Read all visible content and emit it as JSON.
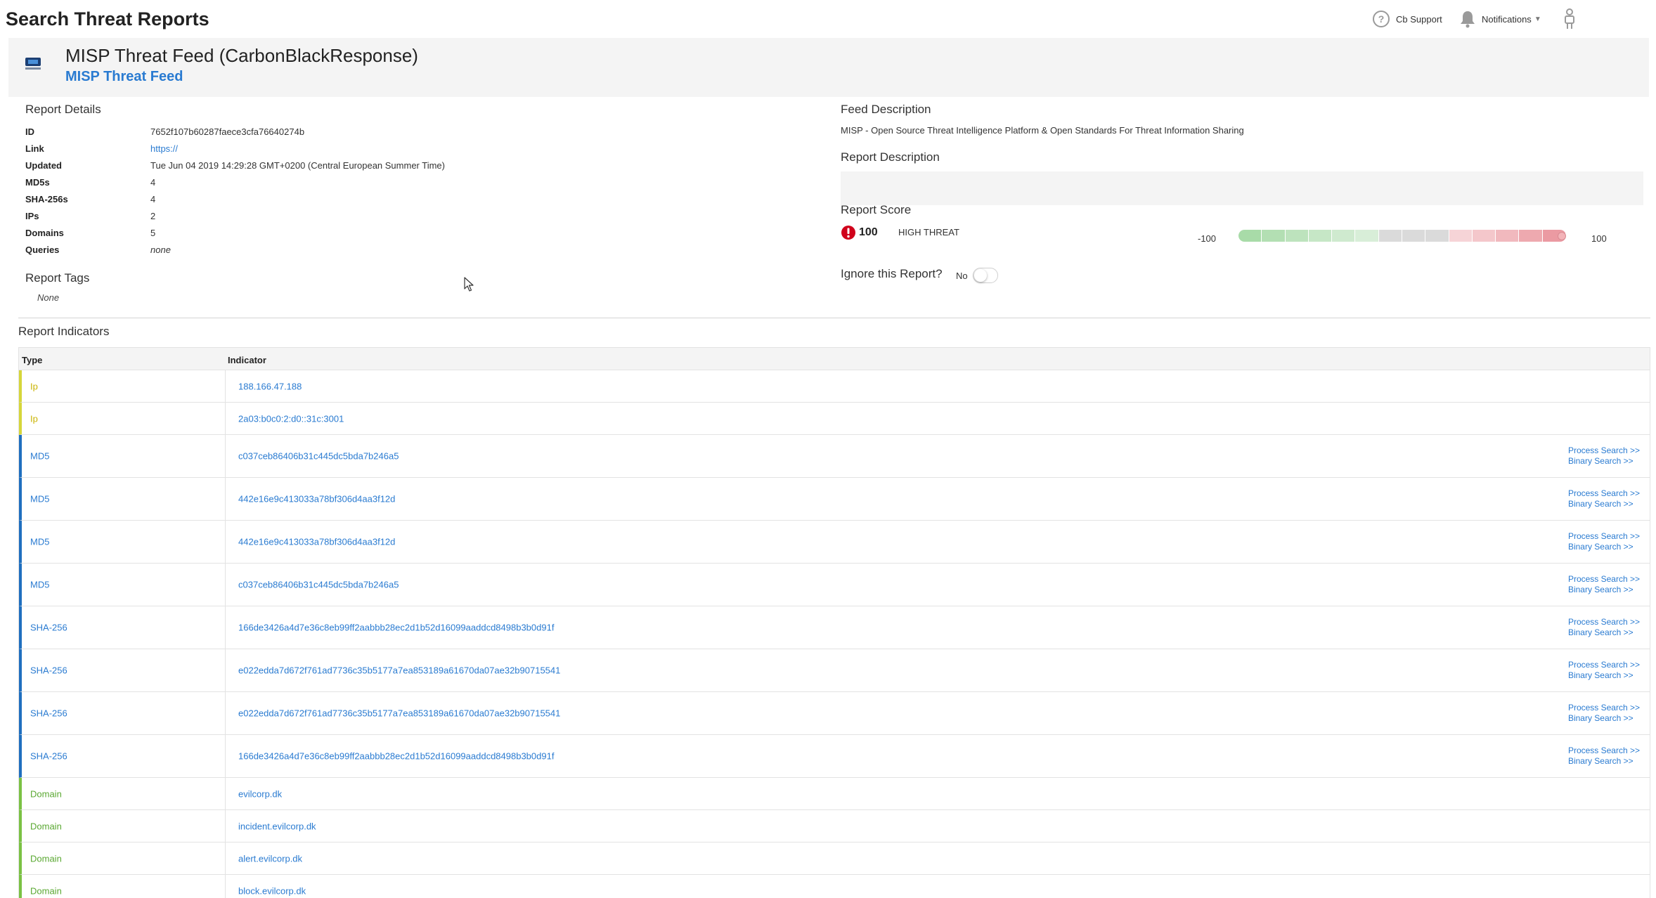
{
  "page": {
    "title": "Search Threat Reports"
  },
  "topbar": {
    "support_label": "Cb Support",
    "notifications_label": "Notifications"
  },
  "feed": {
    "title": "MISP Threat Feed (CarbonBlackResponse)",
    "link_label": "MISP Threat Feed"
  },
  "details": {
    "heading": "Report Details",
    "rows": [
      {
        "key": "ID",
        "value": "7652f107b60287faece3cfa76640274b"
      },
      {
        "key": "Link",
        "value": "https://"
      },
      {
        "key": "Updated",
        "value": "Tue Jun 04 2019 14:29:28 GMT+0200 (Central European Summer Time)"
      },
      {
        "key": "MD5s",
        "value": "4"
      },
      {
        "key": "SHA-256s",
        "value": "4"
      },
      {
        "key": "IPs",
        "value": "2"
      },
      {
        "key": "Domains",
        "value": "5"
      },
      {
        "key": "Queries",
        "value": "none"
      }
    ]
  },
  "tags": {
    "heading": "Report Tags",
    "none_label": "None"
  },
  "feed_description": {
    "heading": "Feed Description",
    "text": "MISP - Open Source Threat Intelligence Platform & Open Standards For Threat Information Sharing"
  },
  "report_description": {
    "heading": "Report Description"
  },
  "score": {
    "heading": "Report Score",
    "value": "100",
    "level": "HIGH THREAT",
    "min_label": "-100",
    "max_label": "100",
    "fraction": 0.99,
    "bar_colors": [
      "#a8dba8",
      "#b3dfb3",
      "#bde3bd",
      "#c6e7c6",
      "#cfeacf",
      "#d8eed8",
      "#dadada",
      "#dadada",
      "#dadada",
      "#f6d4d7",
      "#f4c7cb",
      "#f1b9be",
      "#eea9af",
      "#eb9aa2"
    ],
    "icon_color": "#d0021b"
  },
  "ignore": {
    "label": "Ignore this Report?",
    "value": "No",
    "on": false
  },
  "indicators": {
    "heading": "Report Indicators",
    "columns": {
      "type": "Type",
      "indicator": "Indicator"
    },
    "action_process": "Process Search >>",
    "action_binary": "Binary Search >>",
    "rows": [
      {
        "type": "Ip",
        "value": "188.166.47.188"
      },
      {
        "type": "Ip",
        "value": "2a03:b0c0:2:d0::31c:3001"
      },
      {
        "type": "MD5",
        "value": "c037ceb86406b31c445dc5bda7b246a5"
      },
      {
        "type": "MD5",
        "value": "442e16e9c413033a78bf306d4aa3f12d"
      },
      {
        "type": "MD5",
        "value": "442e16e9c413033a78bf306d4aa3f12d"
      },
      {
        "type": "MD5",
        "value": "c037ceb86406b31c445dc5bda7b246a5"
      },
      {
        "type": "SHA-256",
        "value": "166de3426a4d7e36c8eb99ff2aabbb28ec2d1b52d16099aaddcd8498b3b0d91f"
      },
      {
        "type": "SHA-256",
        "value": "e022edda7d672f761ad7736c35b5177a7ea853189a61670da07ae32b90715541"
      },
      {
        "type": "SHA-256",
        "value": "e022edda7d672f761ad7736c35b5177a7ea853189a61670da07ae32b90715541"
      },
      {
        "type": "SHA-256",
        "value": "166de3426a4d7e36c8eb99ff2aabbb28ec2d1b52d16099aaddcd8498b3b0d91f"
      },
      {
        "type": "Domain",
        "value": "evilcorp.dk"
      },
      {
        "type": "Domain",
        "value": "incident.evilcorp.dk"
      },
      {
        "type": "Domain",
        "value": "alert.evilcorp.dk"
      },
      {
        "type": "Domain",
        "value": "block.evilcorp.dk"
      }
    ]
  }
}
